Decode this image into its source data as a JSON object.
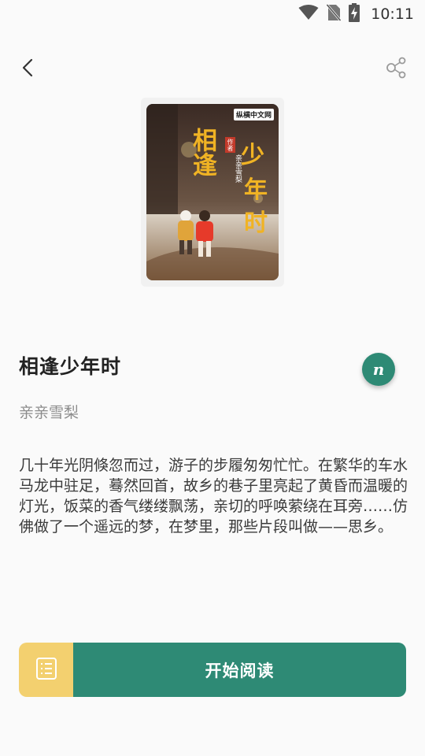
{
  "status_bar": {
    "time": "10:11",
    "icons": [
      "wifi-icon",
      "no-sim-icon",
      "battery-charging-icon"
    ]
  },
  "toolbar": {
    "back_icon": "back-arrow-icon",
    "share_icon": "share-icon"
  },
  "book": {
    "title": "相逢少年时",
    "author": "亲亲雪梨",
    "description": "几十年光阴倏忽而过，游子的步履匆匆忙忙。在繁华的车水马龙中驻足，蓦然回首，故乡的巷子里亮起了黄昏而温暖的灯光，饭菜的香气缕缕飘荡，亲切的呼唤萦绕在耳旁……仿佛做了一个遥远的梦，在梦里，那些片段叫做——思乡。",
    "cover": {
      "publisher_logo": "纵横中文网",
      "title_left": "相逢",
      "title_right_top": "少",
      "title_right_mid": "年",
      "title_right_bottom": "时",
      "author_tag": "作者",
      "author_name": "亲亲雪梨"
    }
  },
  "tts_button": {
    "glyph": "n"
  },
  "bottom_bar": {
    "toc_icon": "list-icon",
    "read_label": "开始阅读"
  },
  "colors": {
    "accent": "#2e8a75",
    "toc_bg": "#f3d06f",
    "background": "#fafafa"
  }
}
